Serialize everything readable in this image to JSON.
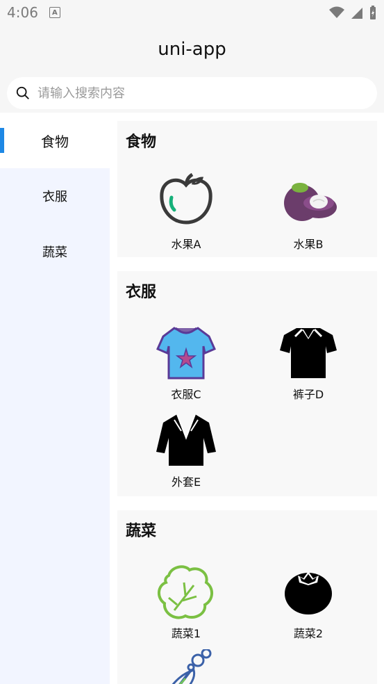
{
  "status": {
    "time": "4:06",
    "a_badge": "A"
  },
  "navbar": {
    "title": "uni-app"
  },
  "search": {
    "placeholder": "请输入搜索内容"
  },
  "sidebar": {
    "items": [
      {
        "label": "食物",
        "active": true
      },
      {
        "label": "衣服",
        "active": false
      },
      {
        "label": "蔬菜",
        "active": false
      }
    ]
  },
  "sections": [
    {
      "title": "食物",
      "items": [
        {
          "label": "水果A",
          "icon": "apple-icon"
        },
        {
          "label": "水果B",
          "icon": "mangosteen-icon"
        }
      ]
    },
    {
      "title": "衣服",
      "items": [
        {
          "label": "衣服C",
          "icon": "tshirt-star-icon"
        },
        {
          "label": "裤子D",
          "icon": "polo-shirt-icon"
        },
        {
          "label": "外套E",
          "icon": "jacket-icon"
        }
      ]
    },
    {
      "title": "蔬菜",
      "items": [
        {
          "label": "蔬菜1",
          "icon": "lettuce-icon"
        },
        {
          "label": "蔬菜2",
          "icon": "tomato-icon"
        },
        {
          "label": "",
          "icon": "carrot-icon"
        }
      ]
    }
  ],
  "colors": {
    "accent": "#1e88e5",
    "sidebar_bg": "#f2f5ff",
    "panel_bg": "#f8f8f8"
  }
}
